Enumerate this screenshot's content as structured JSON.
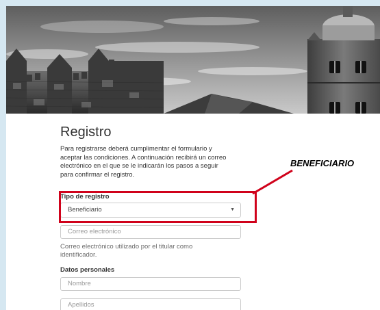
{
  "header": {
    "image_description_icon": "castle-photo"
  },
  "form": {
    "title": "Registro",
    "intro_lines": [
      "Para registrarse deberá cumplimentar el formulario y",
      "aceptar las condiciones. A continuación recibirá un correo",
      "electrónico en el que se le indicarán los pasos a seguir",
      "para confirmar el registro."
    ],
    "registration_type_label": "Tipo de registro",
    "registration_type_value": "Beneficiario",
    "email_placeholder": "Correo electrónico",
    "email_help_lines": [
      "Correo electrónico utilizado por el titular como",
      "identificador."
    ],
    "personal_data_label": "Datos personales",
    "name_placeholder": "Nombre",
    "surname_placeholder": "Apellidos"
  },
  "annotation": {
    "text": "BENEFICIARIO",
    "color": "#d0021b"
  }
}
